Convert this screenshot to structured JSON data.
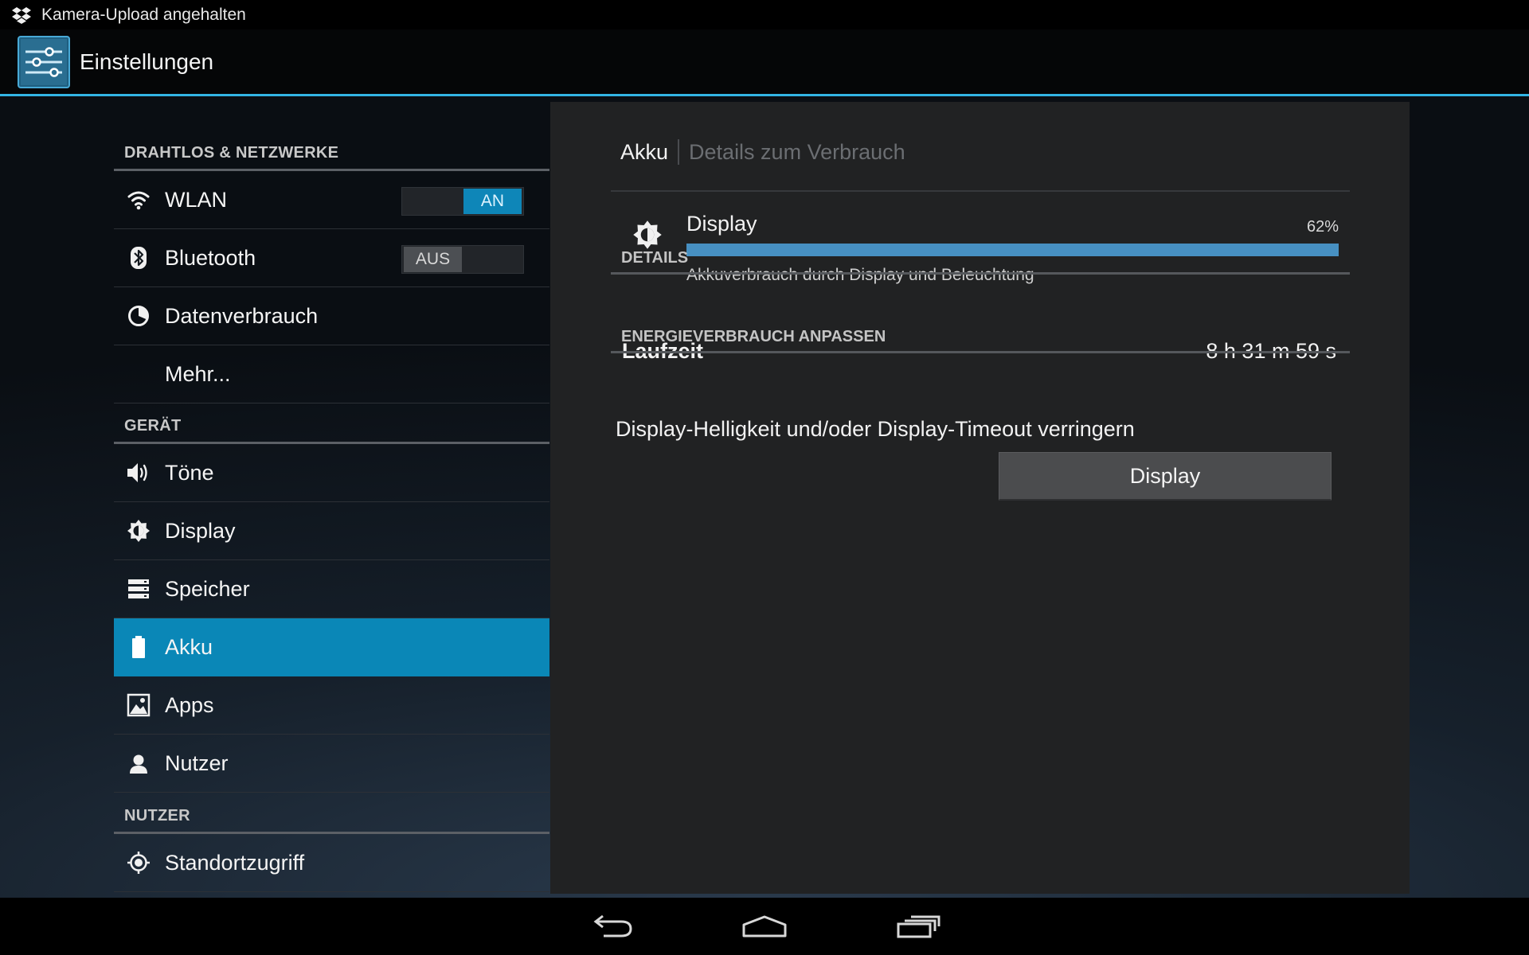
{
  "status_bar": {
    "notification_icon": "dropbox-icon",
    "text": "Kamera-Upload angehalten"
  },
  "action_bar": {
    "app_icon": "settings-sliders-icon",
    "title": "Einstellungen"
  },
  "sections": {
    "wireless": "DRAHTLOS & NETZWERKE",
    "device": "GERÄT",
    "user": "NUTZER"
  },
  "menu": {
    "wlan": {
      "label": "WLAN",
      "icon": "wifi-icon",
      "toggle": "AN"
    },
    "bluetooth": {
      "label": "Bluetooth",
      "icon": "bluetooth-icon",
      "toggle": "AUS"
    },
    "data_usage": {
      "label": "Datenverbrauch",
      "icon": "data-usage-icon"
    },
    "more": {
      "label": "Mehr..."
    },
    "sound": {
      "label": "Töne",
      "icon": "speaker-icon"
    },
    "display": {
      "label": "Display",
      "icon": "brightness-icon"
    },
    "storage": {
      "label": "Speicher",
      "icon": "storage-icon"
    },
    "battery": {
      "label": "Akku",
      "icon": "battery-icon",
      "selected": true
    },
    "apps": {
      "label": "Apps",
      "icon": "apps-icon"
    },
    "users": {
      "label": "Nutzer",
      "icon": "user-icon"
    },
    "location": {
      "label": "Standortzugriff",
      "icon": "location-icon"
    }
  },
  "detail": {
    "breadcrumb": {
      "main": "Akku",
      "sub": "Details zum Verbrauch"
    },
    "usage": {
      "name": "Display",
      "icon": "brightness-icon",
      "percent_label": "62%",
      "percent": 62,
      "description": "Akkuverbrauch durch Display und Beleuchtung"
    },
    "details_header": "DETAILS",
    "runtime_label": "Laufzeit",
    "runtime_value": "8 h 31 m 59 s",
    "adjust_header": "ENERGIEVERBRAUCH ANPASSEN",
    "tip": "Display-Helligkeit und/oder Display-Timeout verringern",
    "button_label": "Display"
  },
  "navigation": {
    "back": "back-icon",
    "home": "home-icon",
    "recents": "recents-icon"
  },
  "colors": {
    "accent": "#33b5e5",
    "selected_item": "#0a87b7",
    "progress": "#4790c2"
  }
}
